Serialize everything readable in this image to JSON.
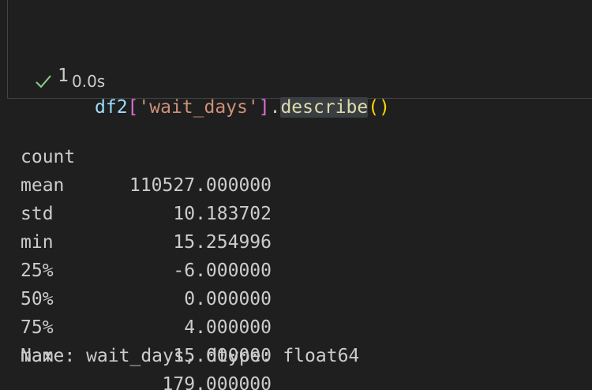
{
  "cell": {
    "line_number": "1",
    "code_tokens": {
      "var": "df2",
      "open_bracket": "[",
      "string": "'wait_days'",
      "close_bracket": "]",
      "dot": ".",
      "method": "describe",
      "parens": "()"
    },
    "status": {
      "icon": "check-icon",
      "duration": "0.0s",
      "color": "#89d185"
    }
  },
  "output": {
    "rows": [
      {
        "label": "count",
        "value": "110527.000000"
      },
      {
        "label": "mean",
        "value": "10.183702"
      },
      {
        "label": "std",
        "value": "15.254996"
      },
      {
        "label": "min",
        "value": "-6.000000"
      },
      {
        "label": "25%",
        "value": "0.000000"
      },
      {
        "label": "50%",
        "value": "4.000000"
      },
      {
        "label": "75%",
        "value": "15.000000"
      },
      {
        "label": "max",
        "value": "179.000000"
      }
    ],
    "footer": "Name: wait_days, dtype: float64"
  }
}
